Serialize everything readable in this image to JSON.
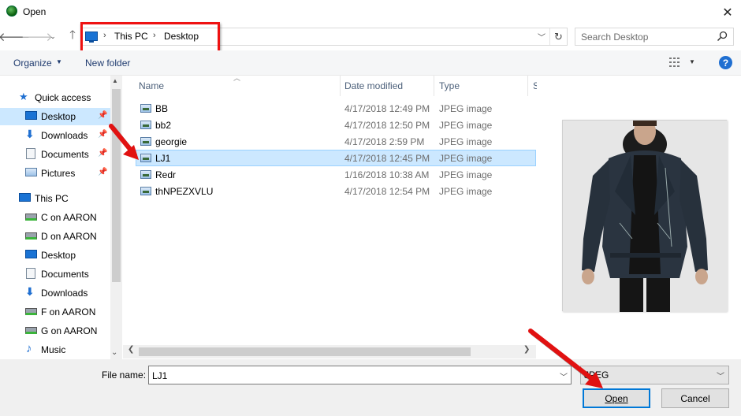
{
  "window": {
    "title": "Open",
    "close_icon": "close-icon"
  },
  "address": {
    "crumbs": [
      "This PC",
      "Desktop"
    ],
    "search_placeholder": "Search Desktop",
    "highlight_color": "#e11111"
  },
  "toolbar": {
    "organize_label": "Organize",
    "new_folder_label": "New folder"
  },
  "nav": {
    "items": [
      {
        "label": "Quick access",
        "icon": "star-icon"
      },
      {
        "label": "Desktop",
        "icon": "desktop-icon",
        "pinned": true,
        "selected": true
      },
      {
        "label": "Downloads",
        "icon": "download-icon",
        "pinned": true
      },
      {
        "label": "Documents",
        "icon": "document-icon",
        "pinned": true
      },
      {
        "label": "Pictures",
        "icon": "pictures-icon",
        "pinned": true
      },
      {
        "label": "This PC",
        "icon": "computer-icon"
      },
      {
        "label": "C on AARON",
        "icon": "network-drive-icon"
      },
      {
        "label": "D on AARON",
        "icon": "network-drive-icon"
      },
      {
        "label": "Desktop",
        "icon": "desktop-icon"
      },
      {
        "label": "Documents",
        "icon": "document-icon"
      },
      {
        "label": "Downloads",
        "icon": "download-icon"
      },
      {
        "label": "F on AARON",
        "icon": "network-drive-icon"
      },
      {
        "label": "G on AARON",
        "icon": "network-drive-icon"
      },
      {
        "label": "Music",
        "icon": "music-icon"
      }
    ]
  },
  "files": {
    "columns": [
      "Name",
      "Date modified",
      "Type",
      "S"
    ],
    "rows": [
      {
        "name": "BB",
        "date": "4/17/2018 12:49 PM",
        "type": "JPEG image"
      },
      {
        "name": "bb2",
        "date": "4/17/2018 12:50 PM",
        "type": "JPEG image"
      },
      {
        "name": "georgie",
        "date": "4/17/2018 2:59 PM",
        "type": "JPEG image"
      },
      {
        "name": "LJ1",
        "date": "4/17/2018 12:45 PM",
        "type": "JPEG image",
        "selected": true
      },
      {
        "name": "Redr",
        "date": "1/16/2018 10:38 AM",
        "type": "JPEG image"
      },
      {
        "name": "thNPEZXVLU",
        "date": "4/17/2018 12:54 PM",
        "type": "JPEG image"
      }
    ]
  },
  "bottom": {
    "filename_label": "File name:",
    "filename_value": "LJ1",
    "filetype_value": "JPEG",
    "open_label": "Open",
    "cancel_label": "Cancel"
  },
  "colors": {
    "accent": "#0078d7",
    "selection": "#cce8ff",
    "annotation": "#e11111"
  }
}
